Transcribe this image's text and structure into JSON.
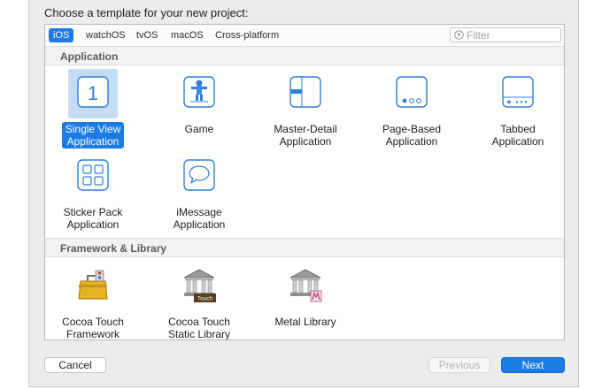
{
  "dialog": {
    "prompt": "Choose a template for your new project:"
  },
  "platform_tabs": [
    {
      "label": "iOS",
      "active": true
    },
    {
      "label": "watchOS",
      "active": false
    },
    {
      "label": "tvOS",
      "active": false
    },
    {
      "label": "macOS",
      "active": false
    },
    {
      "label": "Cross-platform",
      "active": false
    }
  ],
  "filter": {
    "placeholder": "Filter",
    "icon": "filter-icon"
  },
  "sections": [
    {
      "title": "Application",
      "items": [
        {
          "label": "Single View\nApplication",
          "icon": "single-view-app-icon",
          "glyph": "1",
          "selected": true
        },
        {
          "label": "Game",
          "icon": "game-icon",
          "selected": false
        },
        {
          "label": "Master-Detail\nApplication",
          "icon": "master-detail-app-icon",
          "selected": false
        },
        {
          "label": "Page-Based\nApplication",
          "icon": "page-based-app-icon",
          "selected": false
        },
        {
          "label": "Tabbed\nApplication",
          "icon": "tabbed-app-icon",
          "selected": false
        },
        {
          "label": "Sticker Pack\nApplication",
          "icon": "sticker-pack-app-icon",
          "selected": false
        },
        {
          "label": "iMessage\nApplication",
          "icon": "imessage-app-icon",
          "selected": false
        }
      ]
    },
    {
      "title": "Framework & Library",
      "items": [
        {
          "label": "Cocoa Touch\nFramework",
          "icon": "toolbox-framework-icon",
          "selected": false
        },
        {
          "label": "Cocoa Touch\nStatic Library",
          "icon": "library-building-icon",
          "badge": "Touch",
          "selected": false
        },
        {
          "label": "Metal Library",
          "icon": "metal-library-icon",
          "selected": false
        }
      ]
    }
  ],
  "buttons": {
    "cancel": "Cancel",
    "previous": "Previous",
    "next": "Next"
  },
  "colors": {
    "accent": "#1c7ce5",
    "selection_background": "#c6dcf4",
    "sheet_background": "#ececec"
  }
}
